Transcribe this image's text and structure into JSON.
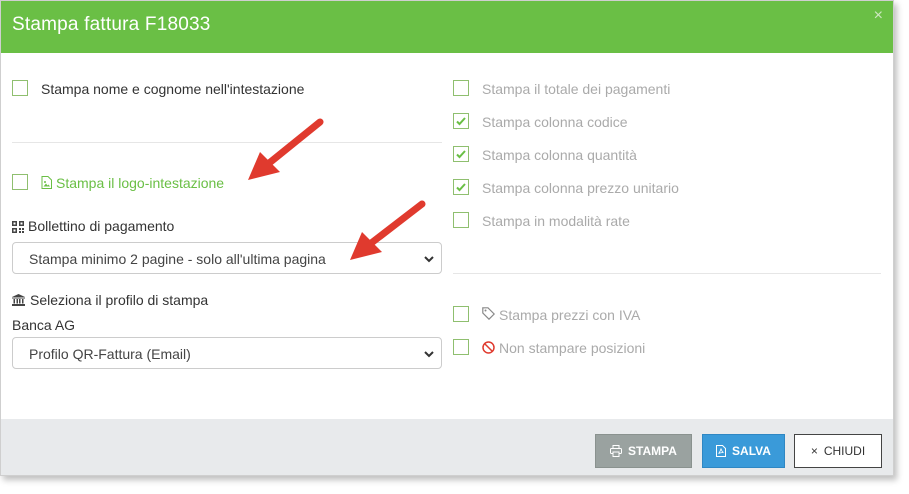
{
  "dialog": {
    "title": "Stampa fattura F18033",
    "close_glyph": "×"
  },
  "left": {
    "print_name": {
      "label": "Stampa nome e cognome nell'intestazione",
      "checked": false
    },
    "print_logo": {
      "label": "Stampa il logo-intestazione",
      "checked": false,
      "icon": "image-file-icon"
    },
    "payment_slip": {
      "label": "Bollettino di pagamento",
      "icon": "qr-code-icon",
      "selected": "Stampa minimo 2 pagine - solo all'ultima pagina"
    },
    "profile": {
      "label": "Seleziona il profilo di stampa",
      "icon": "bank-icon",
      "bank": "Banca AG",
      "selected": "Profilo QR-Fattura (Email)"
    }
  },
  "right": {
    "options": [
      {
        "label": "Stampa il totale dei pagamenti",
        "checked": false
      },
      {
        "label": "Stampa colonna codice",
        "checked": true
      },
      {
        "label": "Stampa colonna quantità",
        "checked": true
      },
      {
        "label": "Stampa colonna prezzo unitario",
        "checked": true
      },
      {
        "label": "Stampa in modalità rate",
        "checked": false
      }
    ],
    "vat_prices": {
      "label": "Stampa prezzi con IVA",
      "checked": false,
      "icon": "tag-icon"
    },
    "no_positions": {
      "label": "Non stampare posizioni",
      "checked": false,
      "icon": "ban-icon"
    }
  },
  "footer": {
    "print_label": "STAMPA",
    "save_label": "SALVA",
    "close_label": "CHIUDI",
    "close_glyph": "×"
  },
  "colors": {
    "header": "#6abf45",
    "accent_green": "#6abf45",
    "save_blue": "#3a9ad9",
    "print_gray": "#9aa2a0",
    "arrow_red": "#e03a2e"
  }
}
